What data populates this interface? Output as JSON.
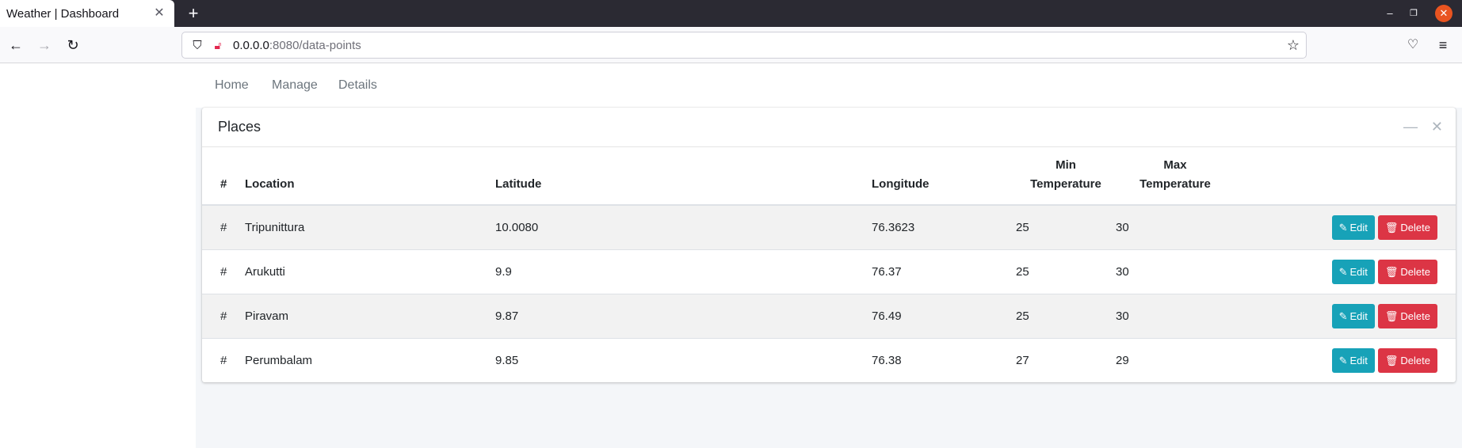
{
  "browser": {
    "tab_title": "Weather | Dashboard",
    "tab_close_icon": "close-icon",
    "new_tab_icon": "plus-icon",
    "url_host": "0.0.0.0",
    "url_rest": ":8080/data-points"
  },
  "nav": {
    "home": "Home",
    "manage": "Manage",
    "details": "Details"
  },
  "card": {
    "title": "Places"
  },
  "table": {
    "headers": {
      "num": "#",
      "location": "Location",
      "latitude": "Latitude",
      "longitude": "Longitude",
      "min_1": "Min",
      "min_2": "Temperature",
      "max_1": "Max",
      "max_2": "Temperature"
    },
    "rows": [
      {
        "num": "#",
        "location": "Tripunittura",
        "latitude": "10.0080",
        "longitude": "76.3623",
        "min": "25",
        "max": "30"
      },
      {
        "num": "#",
        "location": "Arukutti",
        "latitude": "9.9",
        "longitude": "76.37",
        "min": "25",
        "max": "30"
      },
      {
        "num": "#",
        "location": "Piravam",
        "latitude": "9.87",
        "longitude": "76.49",
        "min": "25",
        "max": "30"
      },
      {
        "num": "#",
        "location": "Perumbalam",
        "latitude": "9.85",
        "longitude": "76.38",
        "min": "27",
        "max": "29"
      }
    ],
    "edit_label": "Edit",
    "delete_label": "Delete"
  },
  "colors": {
    "edit": "#17a2b8",
    "delete": "#dc3545",
    "content_bg": "#f4f6f9"
  }
}
